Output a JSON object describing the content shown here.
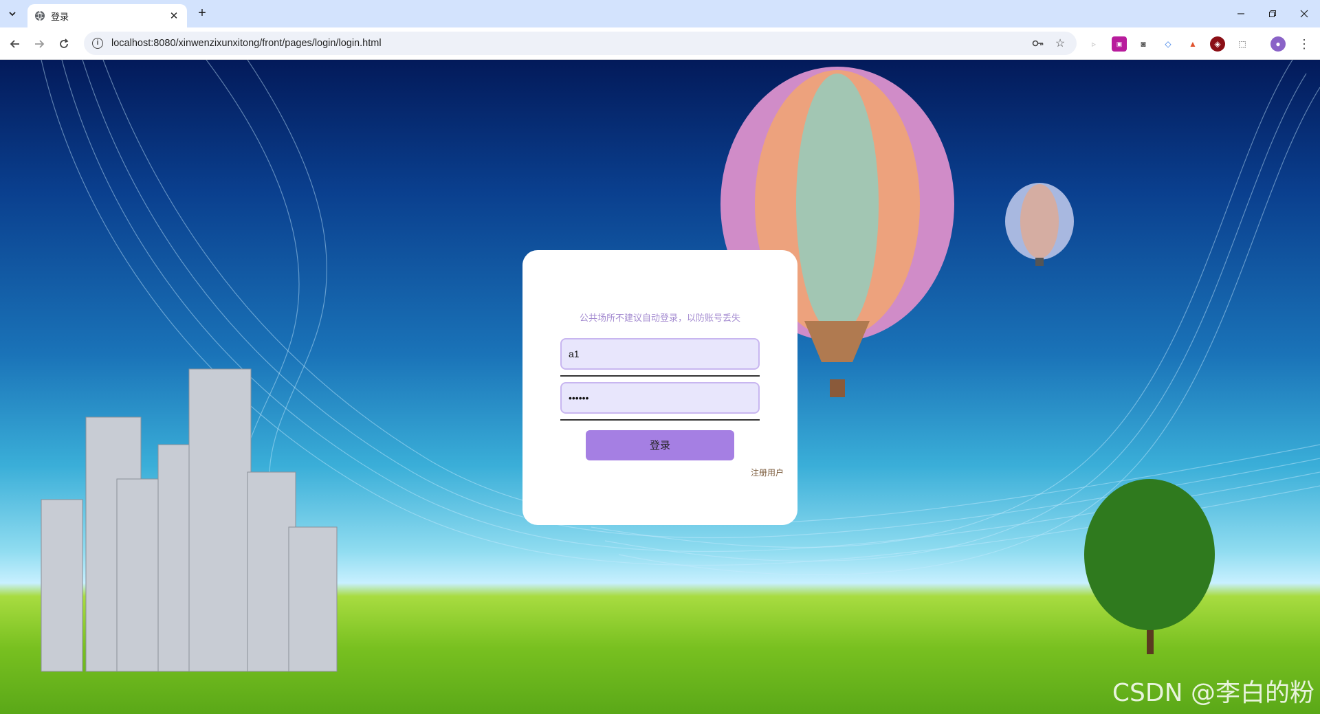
{
  "browser": {
    "tab": {
      "title": "登录"
    },
    "address_bar": {
      "url": "localhost:8080/xinwenzixunxitong/front/pages/login/login.html"
    }
  },
  "login_form": {
    "notice": "公共场所不建议自动登录，以防账号丢失",
    "username": {
      "value": "a1"
    },
    "password": {
      "value": "••••••"
    },
    "login_button": "登录",
    "register_link": "注册用户"
  },
  "watermark": "CSDN @李白的粉",
  "colors": {
    "button": "#a57fe3",
    "notice": "#a38ad0",
    "input_bg": "#e8e6fc",
    "tab_strip": "#d3e3fd"
  }
}
